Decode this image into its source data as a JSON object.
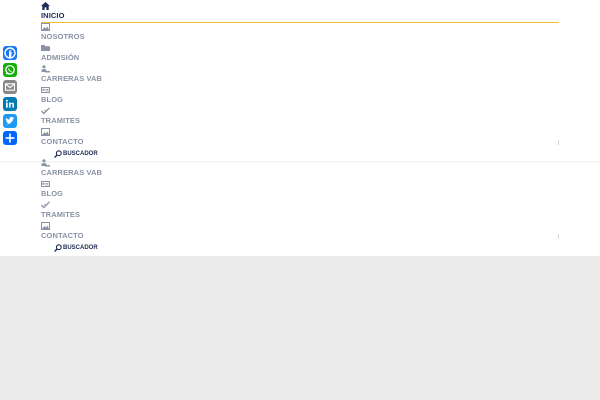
{
  "menu": {
    "items": [
      {
        "label": "INICIO",
        "icon": "home-icon",
        "active": true
      },
      {
        "label": "NOSOTROS",
        "icon": "image-icon"
      },
      {
        "label": "ADMISIÓN",
        "icon": "folder-icon"
      },
      {
        "label": "CARRERAS VAB",
        "icon": "person-desk-icon"
      },
      {
        "label": "BLOG",
        "icon": "id-card-icon"
      },
      {
        "label": "TRAMITES",
        "icon": "check-icon"
      },
      {
        "label": "CONTACTO",
        "icon": "image-icon"
      }
    ],
    "search_label": "BUSCADOR"
  },
  "menu_sticky": {
    "items": [
      {
        "label": "CARRERAS VAB",
        "icon": "person-desk-icon"
      },
      {
        "label": "BLOG",
        "icon": "id-card-icon"
      },
      {
        "label": "TRAMITES",
        "icon": "check-icon"
      },
      {
        "label": "CONTACTO",
        "icon": "image-icon"
      }
    ],
    "search_label": "BUSCADOR"
  },
  "share_bar": {
    "buttons": [
      {
        "name": "Facebook",
        "icon": "facebook-icon",
        "color": "#1877f2"
      },
      {
        "name": "WhatsApp",
        "icon": "whatsapp-icon",
        "color": "#12af0a"
      },
      {
        "name": "Email",
        "icon": "email-icon",
        "color": "#888888"
      },
      {
        "name": "LinkedIn",
        "icon": "linkedin-icon",
        "color": "#007bb5"
      },
      {
        "name": "Twitter",
        "icon": "twitter-icon",
        "color": "#1d9bf0"
      },
      {
        "name": "Share",
        "icon": "share-plus-icon",
        "color": "#0166ff"
      }
    ]
  },
  "colors": {
    "accent": "#f0c032",
    "nav_active": "#1d2b53",
    "nav_inactive": "#8a93a6",
    "page_bg": "#ebebeb"
  }
}
